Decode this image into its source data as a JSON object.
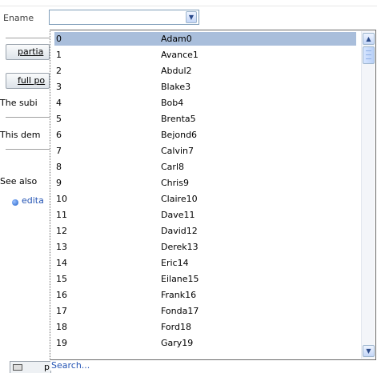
{
  "form": {
    "ename_label": "Ename",
    "ename_value": ""
  },
  "background": {
    "partial_button_label": "partia",
    "full_button_label": "full po",
    "text_line1": "The subi",
    "text_line2": "This dem",
    "text_line3": "See also",
    "link_label": "edita",
    "print_label": "p"
  },
  "dropdown": {
    "rows": [
      {
        "index": "0",
        "name": "Adam0",
        "selected": true
      },
      {
        "index": "1",
        "name": "Avance1"
      },
      {
        "index": "2",
        "name": "Abdul2"
      },
      {
        "index": "3",
        "name": "Blake3"
      },
      {
        "index": "4",
        "name": "Bob4"
      },
      {
        "index": "5",
        "name": "Brenta5"
      },
      {
        "index": "6",
        "name": "Bejond6"
      },
      {
        "index": "7",
        "name": "Calvin7"
      },
      {
        "index": "8",
        "name": "Carl8"
      },
      {
        "index": "9",
        "name": "Chris9"
      },
      {
        "index": "10",
        "name": "Claire10"
      },
      {
        "index": "11",
        "name": "Dave11"
      },
      {
        "index": "12",
        "name": "David12"
      },
      {
        "index": "13",
        "name": "Derek13"
      },
      {
        "index": "14",
        "name": "Eric14"
      },
      {
        "index": "15",
        "name": "Eilane15"
      },
      {
        "index": "16",
        "name": "Frank16"
      },
      {
        "index": "17",
        "name": "Fonda17"
      },
      {
        "index": "18",
        "name": "Ford18"
      },
      {
        "index": "19",
        "name": "Gary19"
      }
    ],
    "search_label": "Search...",
    "colors": {
      "selected_row": "#a9bedb",
      "link": "#2454b4"
    },
    "icons": {
      "scroll_up": "chevron-up-icon",
      "scroll_down": "chevron-down-icon",
      "combo_arrow": "chevron-down-icon"
    }
  }
}
